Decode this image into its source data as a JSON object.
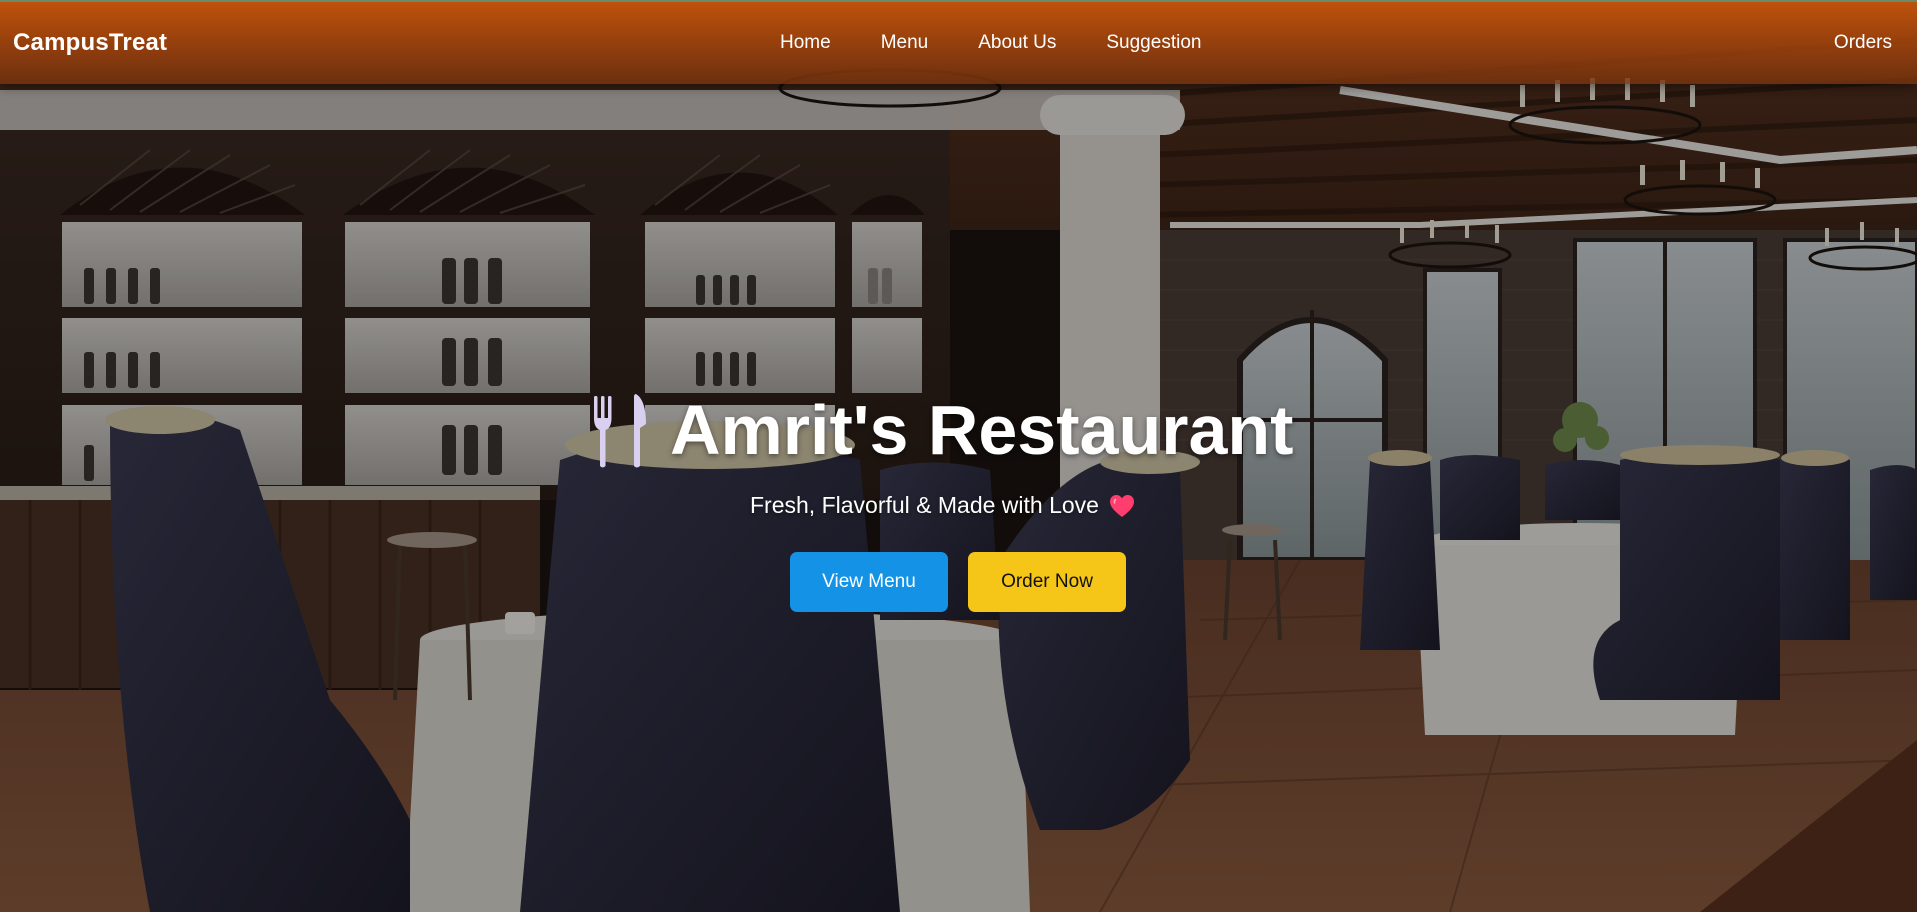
{
  "navbar": {
    "brand": "CampusTreat",
    "links": [
      {
        "label": "Home"
      },
      {
        "label": "Menu"
      },
      {
        "label": "About Us"
      },
      {
        "label": "Suggestion"
      }
    ],
    "orders_label": "Orders",
    "color": "#c4540a"
  },
  "hero": {
    "icon": "utensils-icon",
    "title": "Amrit's Restaurant",
    "tagline": "Fresh, Flavorful & Made with Love",
    "tagline_icon": "heart-icon",
    "buttons": {
      "view_menu": "View Menu",
      "order_now": "Order Now"
    },
    "background": "restaurant-interior-photo"
  },
  "colors": {
    "primary_button": "#1392e6",
    "secondary_button": "#f5c518",
    "heart": "#ff3d6e"
  }
}
